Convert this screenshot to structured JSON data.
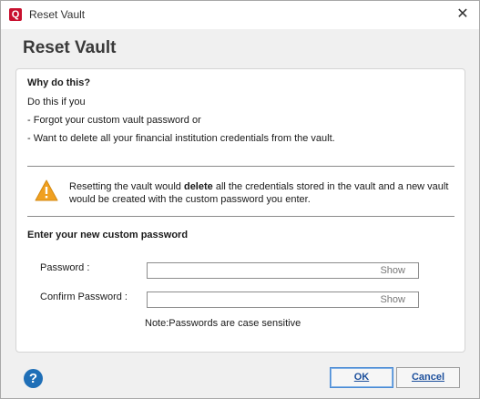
{
  "window": {
    "title": "Reset Vault",
    "close_glyph": "✕",
    "logo_letter": "Q"
  },
  "heading": "Reset Vault",
  "why": {
    "title": "Why do this?",
    "lines": [
      "Do this if you",
      "- Forgot your custom vault password or",
      "- Want to delete all your financial institution credentials from the vault."
    ]
  },
  "warning": {
    "icon": "warning-triangle-icon",
    "before": "Resetting the vault would ",
    "bold": "delete",
    "after": " all the credentials stored in the vault and a new vault would be created with the custom password you enter."
  },
  "form": {
    "section_title": "Enter your new custom password",
    "password_label": "Password :",
    "password_value": "",
    "confirm_label": "Confirm Password :",
    "confirm_value": "",
    "show_label": "Show",
    "note": "Note:Passwords are case sensitive"
  },
  "footer": {
    "help_glyph": "?",
    "ok_label": "OK",
    "cancel_label": "Cancel"
  },
  "colors": {
    "accent": "#1f6fb7",
    "warning": "#f0a020",
    "brand": "#c8102e"
  }
}
